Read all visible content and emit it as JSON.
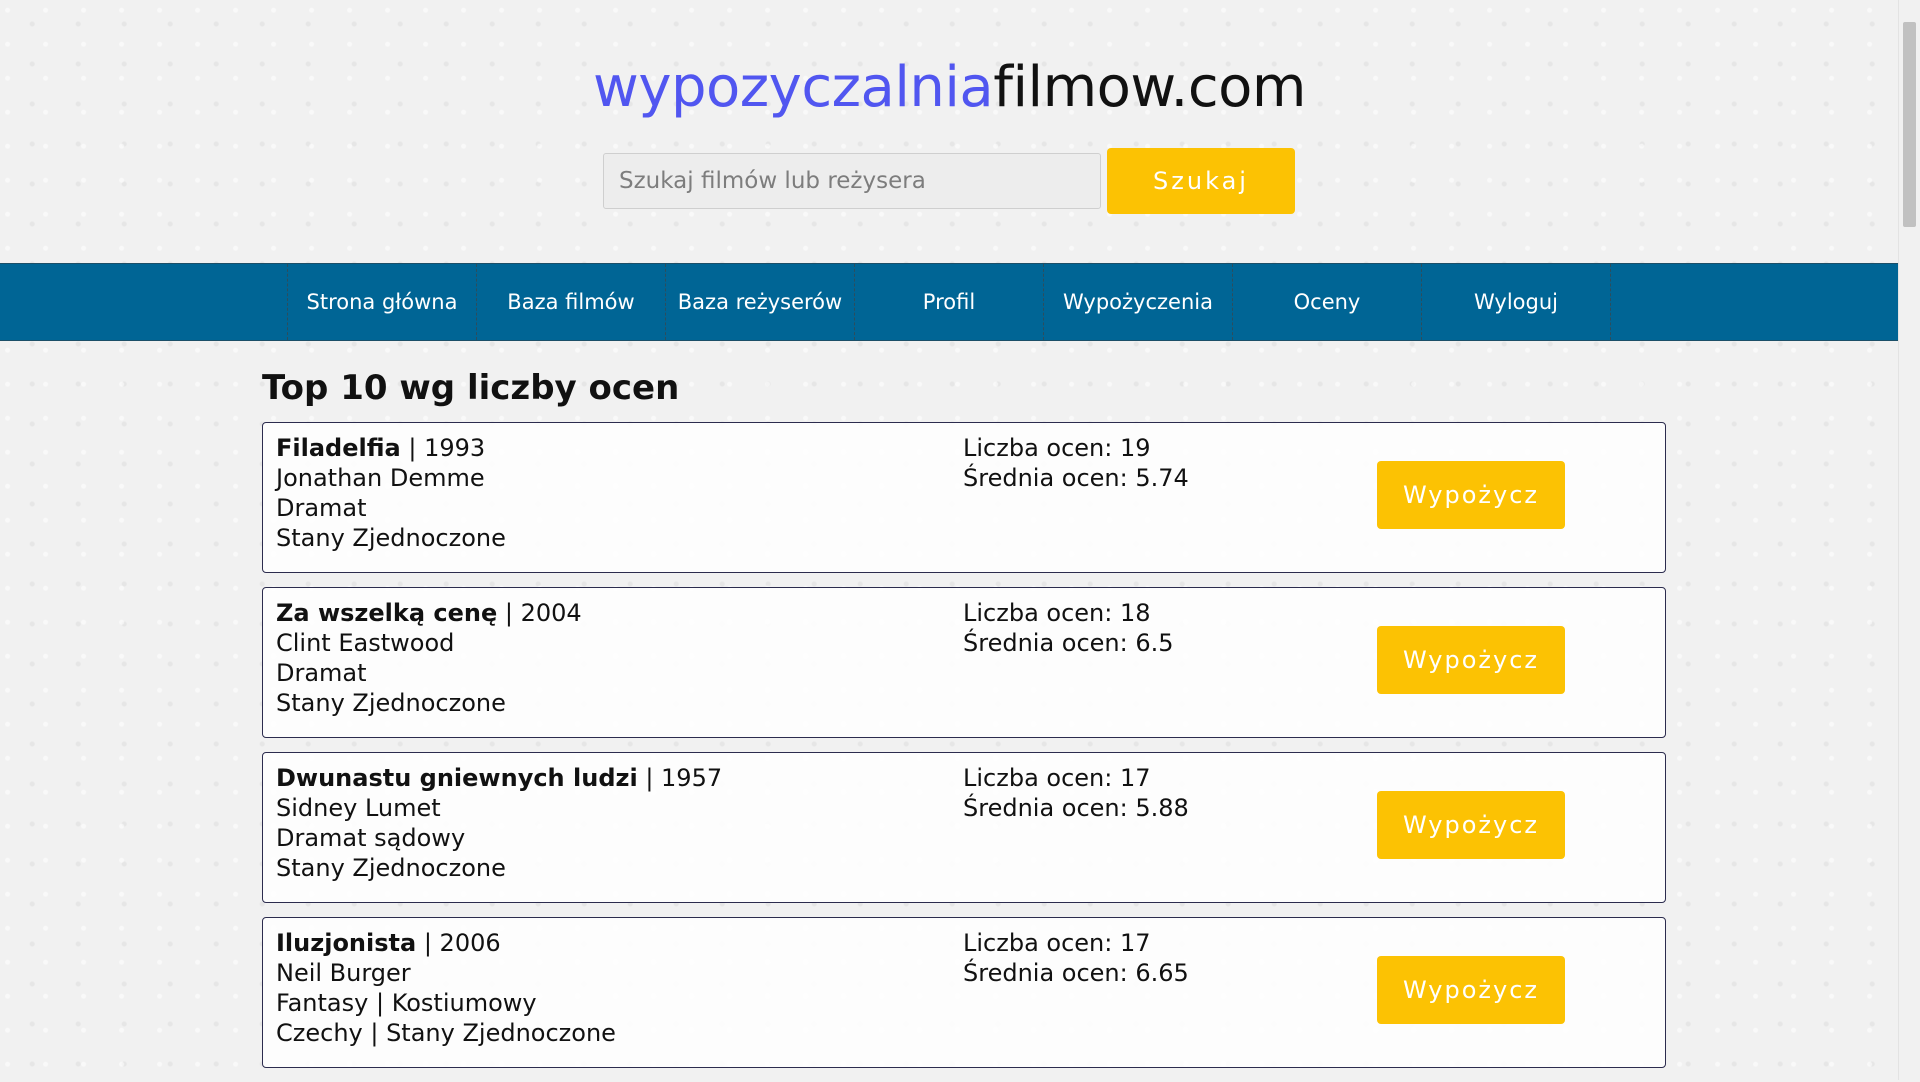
{
  "header": {
    "logo_part1": "wypozyczalnia",
    "logo_part2": "filmow.com"
  },
  "search": {
    "placeholder": "Szukaj filmów lub reżysera",
    "value": "",
    "button_label": "Szukaj"
  },
  "nav": {
    "items": [
      {
        "label": "Strona główna"
      },
      {
        "label": "Baza filmów"
      },
      {
        "label": "Baza reżyserów"
      },
      {
        "label": "Profil"
      },
      {
        "label": "Wypożyczenia"
      },
      {
        "label": "Oceny"
      },
      {
        "label": "Wyloguj"
      }
    ]
  },
  "main": {
    "section_title": "Top 10 wg liczby ocen",
    "movies": [
      {
        "title": "Filadelfia",
        "year_text": " | 1993",
        "director": "Jonathan Demme",
        "genres": "Dramat",
        "countries": "Stany Zjednoczone",
        "ratings_count": "Liczba ocen: 19",
        "ratings_avg": "Średnia ocen: 5.74",
        "button_label": "Wypożycz"
      },
      {
        "title": "Za wszelką cenę",
        "year_text": " | 2004",
        "director": "Clint Eastwood",
        "genres": "Dramat",
        "countries": "Stany Zjednoczone",
        "ratings_count": "Liczba ocen: 18",
        "ratings_avg": "Średnia ocen: 6.5",
        "button_label": "Wypożycz"
      },
      {
        "title": "Dwunastu gniewnych ludzi",
        "year_text": " | 1957",
        "director": "Sidney Lumet",
        "genres": "Dramat sądowy",
        "countries": "Stany Zjednoczone",
        "ratings_count": "Liczba ocen: 17",
        "ratings_avg": "Średnia ocen: 5.88",
        "button_label": "Wypożycz"
      },
      {
        "title": "Iluzjonista",
        "year_text": " | 2006",
        "director": "Neil Burger",
        "genres": "Fantasy | Kostiumowy",
        "countries": "Czechy | Stany Zjednoczone",
        "ratings_count": "Liczba ocen: 17",
        "ratings_avg": "Średnia ocen: 6.65",
        "button_label": "Wypożycz"
      }
    ]
  },
  "colors": {
    "logo_blue": "#5156f0",
    "nav_blue": "#006595",
    "button_yellow": "#fcc203"
  }
}
